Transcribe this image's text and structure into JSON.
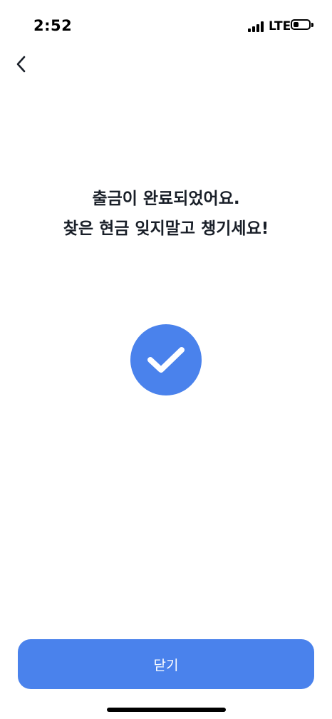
{
  "status_bar": {
    "time": "2:52",
    "network": "LTE",
    "signal_bars": 4,
    "battery_level": 0.35
  },
  "header": {
    "back_icon": "chevron-left-icon"
  },
  "message": {
    "line1": "출금이 완료되었어요.",
    "line2": "찾은 현금 잊지말고 챙기세요!"
  },
  "success_icon": "checkmark-icon",
  "footer": {
    "close_label": "닫기"
  },
  "colors": {
    "accent": "#4a82ec",
    "text": "#191f28",
    "background": "#ffffff"
  }
}
